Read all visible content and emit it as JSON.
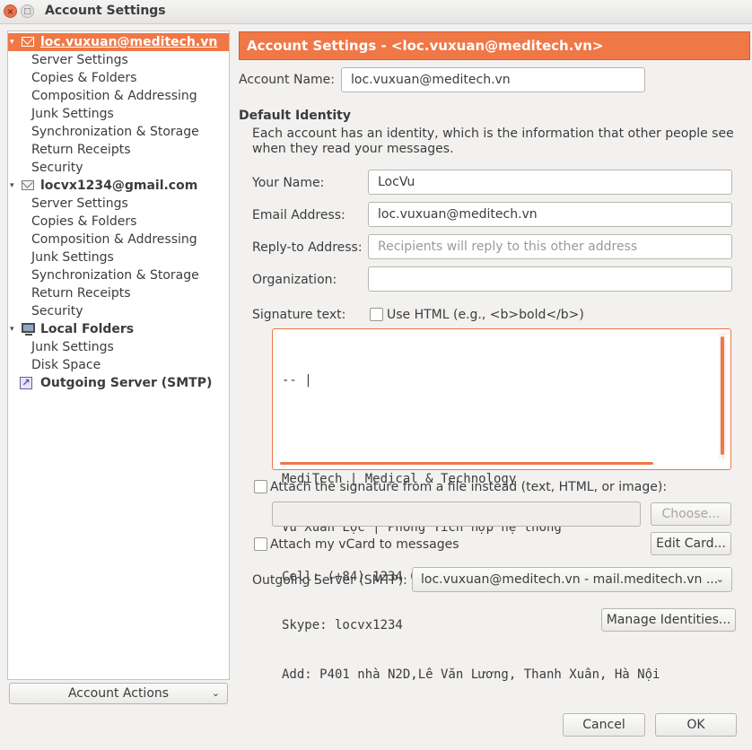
{
  "window": {
    "title": "Account Settings",
    "close_glyph": "×",
    "maximize_glyph": "□"
  },
  "sidebar": {
    "accounts": [
      {
        "label": "loc.vuxuan@meditech.vn",
        "icon": "envelope-icon",
        "expanded": true,
        "selected": true,
        "items": [
          "Server Settings",
          "Copies & Folders",
          "Composition & Addressing",
          "Junk Settings",
          "Synchronization & Storage",
          "Return Receipts",
          "Security"
        ]
      },
      {
        "label": "locvx1234@gmail.com",
        "icon": "envelope-icon",
        "expanded": true,
        "selected": false,
        "items": [
          "Server Settings",
          "Copies & Folders",
          "Composition & Addressing",
          "Junk Settings",
          "Synchronization & Storage",
          "Return Receipts",
          "Security"
        ]
      },
      {
        "label": "Local Folders",
        "icon": "computer-icon",
        "expanded": true,
        "selected": false,
        "items": [
          "Junk Settings",
          "Disk Space"
        ]
      },
      {
        "label": "Outgoing Server (SMTP)",
        "icon": "outgoing-server-icon",
        "expanded": false,
        "selected": false,
        "items": []
      }
    ],
    "expand_glyph": "▾",
    "account_actions_label": "Account Actions",
    "dropdown_glyph": "⌄"
  },
  "main": {
    "header": "Account Settings - <loc.vuxuan@meditech.vn>",
    "account_name_label": "Account Name:",
    "account_name_value": "loc.vuxuan@meditech.vn",
    "default_identity_heading": "Default Identity",
    "identity_description_line1": "Each account has an identity, which is the information that other people see",
    "identity_description_line2": "when they read your messages.",
    "your_name_label": "Your Name:",
    "your_name_value": "LocVu",
    "email_label": "Email Address:",
    "email_value": "loc.vuxuan@meditech.vn",
    "reply_to_label": "Reply-to Address:",
    "reply_to_placeholder": "Recipients will reply to this other address",
    "organization_label": "Organization:",
    "organization_value": "",
    "signature_label": "Signature text:",
    "use_html_label": "Use HTML (e.g., <b>bold</b>)",
    "use_html_checked": false,
    "signature_lines": [
      "-- |",
      "",
      "MediTech | Medical & Technology",
      "Vũ Xuân Lộc | Phòng Tích hợp hệ thống",
      "Cell: (+84) 1234 633 597",
      "Skype: locvx1234",
      "Add: P401 nhà N2D,Lê Văn Lương, Thanh Xuân, Hà Nội"
    ],
    "attach_file_label": "Attach the signature from a file instead (text, HTML, or image):",
    "attach_file_checked": false,
    "file_path_value": "",
    "choose_label": "Choose...",
    "attach_vcard_label": "Attach my vCard to messages",
    "attach_vcard_checked": false,
    "edit_card_label": "Edit Card...",
    "smtp_label": "Outgoing Server (SMTP):",
    "smtp_value": "loc.vuxuan@meditech.vn - mail.meditech.vn ...",
    "manage_identities_label": "Manage Identities..."
  },
  "footer": {
    "cancel_label": "Cancel",
    "ok_label": "OK"
  },
  "colors": {
    "accent": "#f07746",
    "window_bg": "#f2f1f0",
    "text": "#3c3c3c"
  }
}
